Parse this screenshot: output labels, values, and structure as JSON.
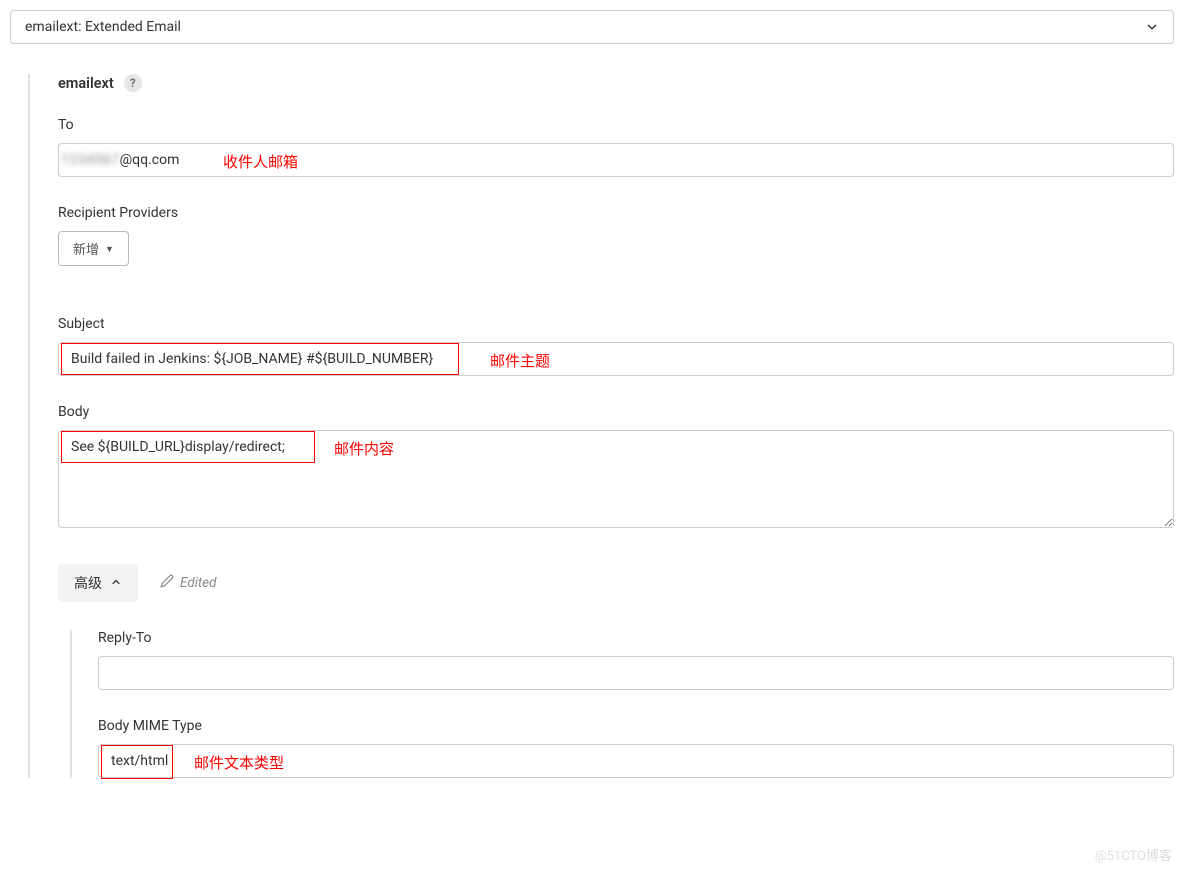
{
  "dropdown": {
    "label": "emailext: Extended Email"
  },
  "section": {
    "name": "emailext",
    "help": "?"
  },
  "fields": {
    "to": {
      "label": "To",
      "value_prefix": "1234567",
      "value_suffix": "@qq.com",
      "annotation": "收件人邮箱"
    },
    "recipientProviders": {
      "label": "Recipient Providers",
      "addButton": "新增"
    },
    "subject": {
      "label": "Subject",
      "value": "Build failed in Jenkins: ${JOB_NAME} #${BUILD_NUMBER}",
      "annotation": "邮件主题"
    },
    "body": {
      "label": "Body",
      "value": "See ${BUILD_URL}display/redirect;",
      "annotation": "邮件内容"
    },
    "replyTo": {
      "label": "Reply-To",
      "value": ""
    },
    "mimeType": {
      "label": "Body MIME Type",
      "value": "text/html",
      "annotation": "邮件文本类型"
    }
  },
  "advanced": {
    "label": "高级",
    "edited": "Edited"
  },
  "watermark": "@51CTO博客"
}
